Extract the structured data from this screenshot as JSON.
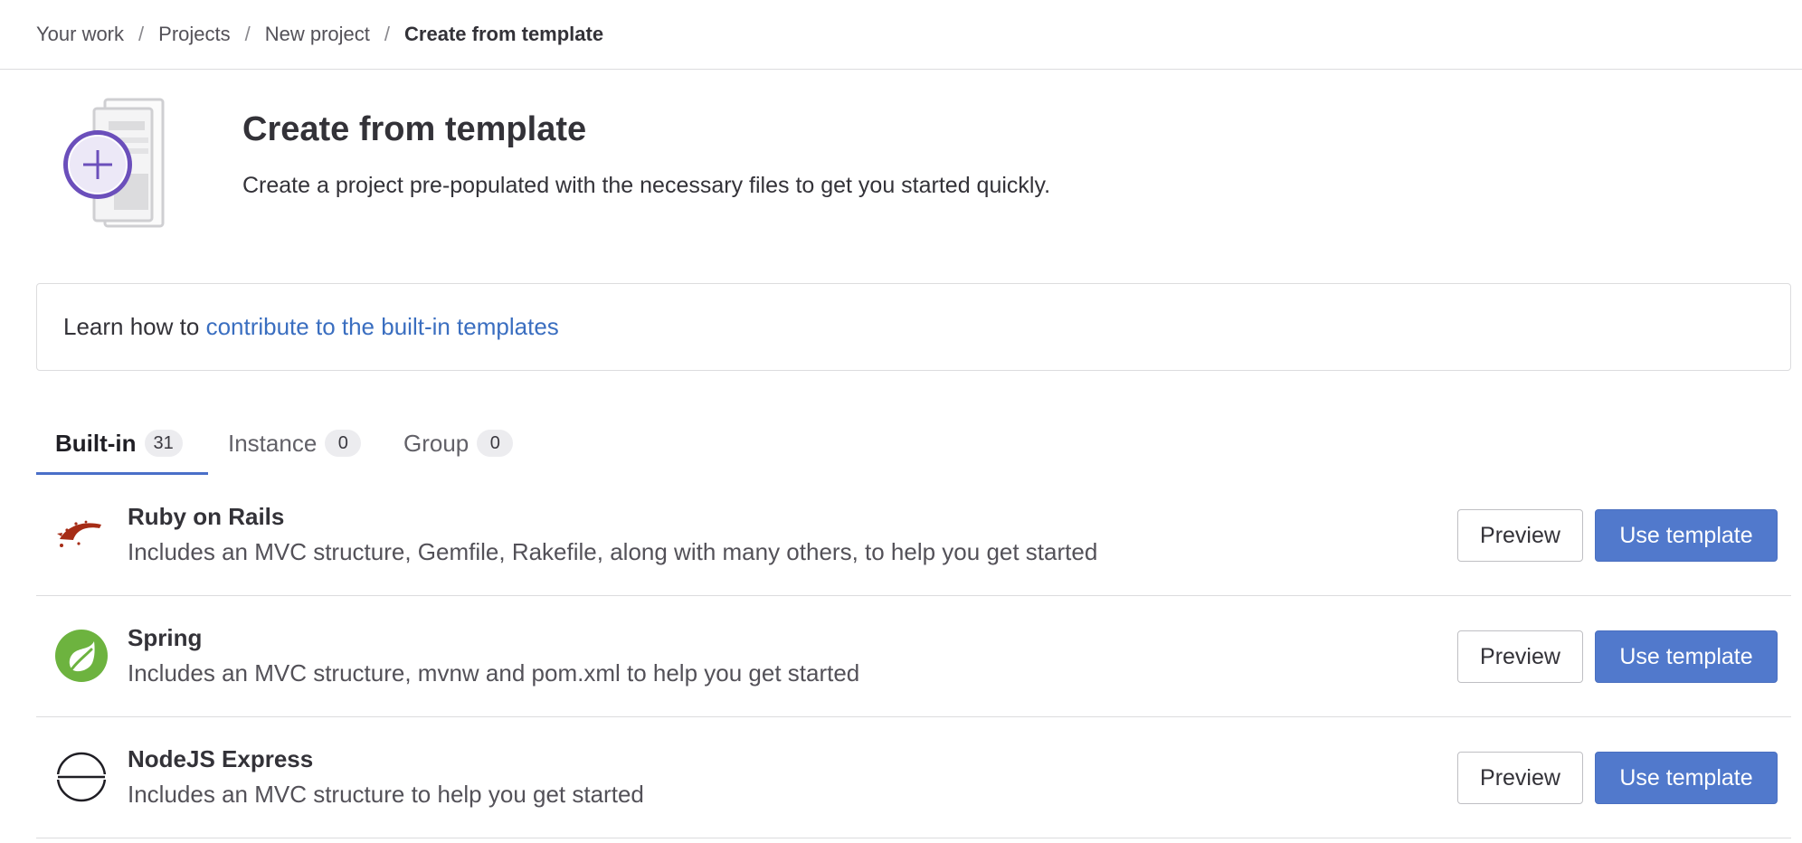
{
  "breadcrumb": {
    "items": [
      "Your work",
      "Projects",
      "New project"
    ],
    "current": "Create from template",
    "separator": "/"
  },
  "header": {
    "title": "Create from template",
    "subtitle": "Create a project pre-populated with the necessary files to get you started quickly.",
    "illustration_icon": "plus-circle-document-icon"
  },
  "info": {
    "lead": "Learn how to ",
    "link_text": "contribute to the built-in templates"
  },
  "tabs": [
    {
      "label": "Built-in",
      "count": "31",
      "active": true
    },
    {
      "label": "Instance",
      "count": "0",
      "active": false
    },
    {
      "label": "Group",
      "count": "0",
      "active": false
    }
  ],
  "templates": [
    {
      "name": "Ruby on Rails",
      "description": "Includes an MVC structure, Gemfile, Rakefile, along with many others, to help you get started",
      "icon": "rails-icon"
    },
    {
      "name": "Spring",
      "description": "Includes an MVC structure, mvnw and pom.xml to help you get started",
      "icon": "spring-icon"
    },
    {
      "name": "NodeJS Express",
      "description": "Includes an MVC structure to help you get started",
      "icon": "express-icon"
    }
  ],
  "buttons": {
    "preview": "Preview",
    "use": "Use template"
  },
  "colors": {
    "accent": "#5179cc",
    "link": "#3a6ec0",
    "illustration": "#6b4fbb",
    "rails": "#a62c16",
    "spring": "#6db33f",
    "border": "#dcdcde"
  }
}
